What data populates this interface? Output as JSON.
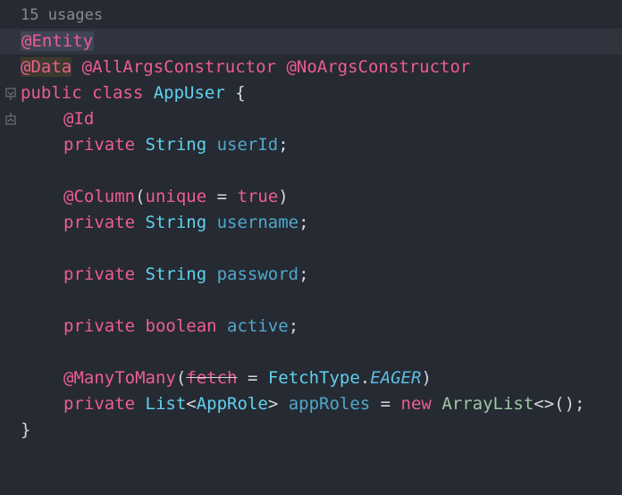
{
  "editor": {
    "usages_hint": "15 usages",
    "lines": {
      "l1": {
        "a": "@Entity"
      },
      "l2": {
        "a": "@Data",
        "b": " ",
        "c": "@AllArgsConstructor",
        "d": " ",
        "e": "@NoArgsConstructor"
      },
      "l3": {
        "a": "public class ",
        "b": "AppUser",
        "c": " {"
      },
      "l4": {
        "a": "@Id"
      },
      "l5": {
        "a": "private ",
        "b": "String",
        "c": " ",
        "d": "userId",
        "e": ";"
      },
      "l7": {
        "a": "@Column",
        "b": "(",
        "c": "unique",
        "d": " = ",
        "e": "true",
        "f": ")"
      },
      "l8": {
        "a": "private ",
        "b": "String",
        "c": " ",
        "d": "username",
        "e": ";"
      },
      "l10": {
        "a": "private ",
        "b": "String",
        "c": " ",
        "d": "password",
        "e": ";"
      },
      "l12": {
        "a": "private ",
        "b": "boolean",
        "c": " ",
        "d": "active",
        "e": ";"
      },
      "l14": {
        "a": "@ManyToMany",
        "b": "(",
        "c": "fetch",
        "d": " = ",
        "e": "FetchType",
        "f": ".",
        "g": "EAGER",
        "h": ")"
      },
      "l15": {
        "a": "private ",
        "b": "List",
        "c": "<",
        "d": "AppRole",
        "e": "> ",
        "f": "appRoles",
        "g": " = ",
        "h": "new ",
        "i": "ArrayList",
        "j": "<>();"
      },
      "l16": {
        "a": "}"
      }
    }
  },
  "colors": {
    "background": "#262a33",
    "current_line": "#2f343e",
    "keyword": "#ee5d93",
    "type": "#5fd2ee",
    "field": "#4fa8ca",
    "comment_hint": "#878b94"
  }
}
